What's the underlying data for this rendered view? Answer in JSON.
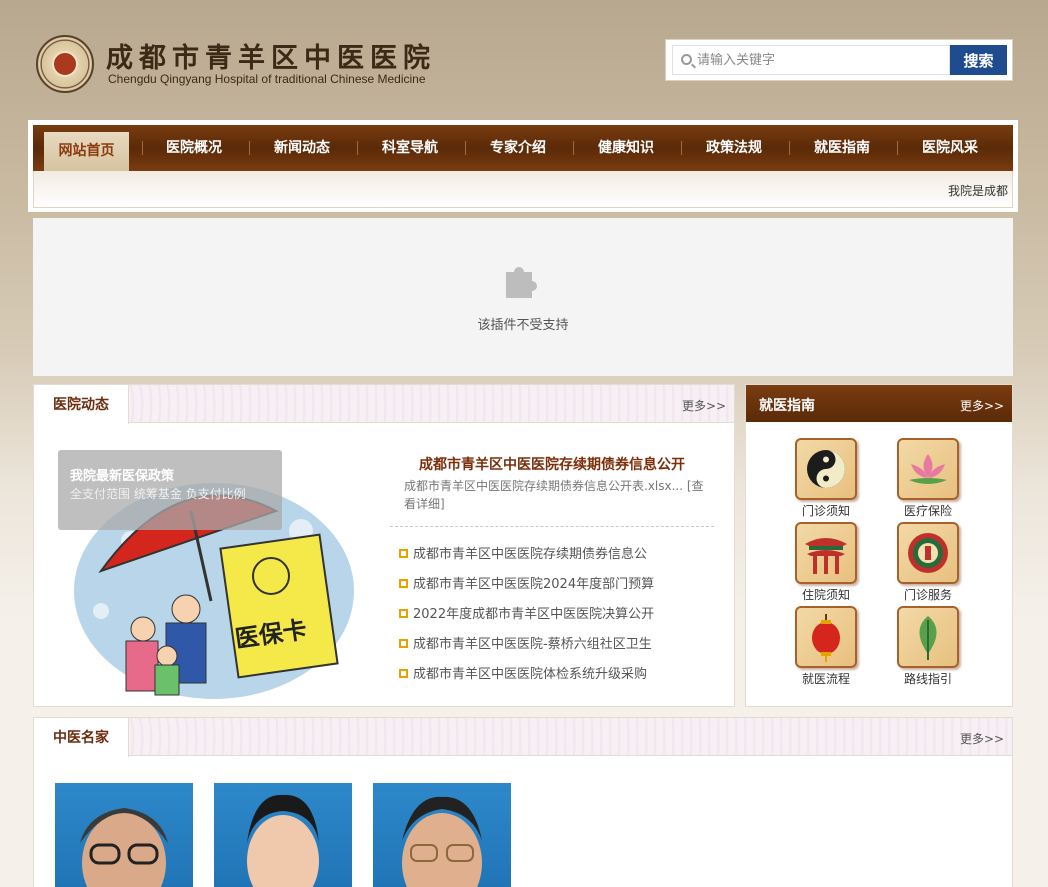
{
  "header": {
    "title": "成都市青羊区中医医院",
    "subtitle": "Chengdu Qingyang Hospital of traditional Chinese Medicine"
  },
  "search": {
    "placeholder": "请输入关键字",
    "button_label": "搜索"
  },
  "nav": {
    "items": [
      {
        "label": "网站首页",
        "active": true
      },
      {
        "label": "医院概况"
      },
      {
        "label": "新闻动态"
      },
      {
        "label": "科室导航"
      },
      {
        "label": "专家介绍"
      },
      {
        "label": "健康知识"
      },
      {
        "label": "政策法规"
      },
      {
        "label": "就医指南"
      },
      {
        "label": "医院风采"
      }
    ],
    "marquee_text": "我院是成都"
  },
  "plugin": {
    "message": "该插件不受支持"
  },
  "news_panel": {
    "title": "医院动态",
    "more_label": "更多>>",
    "slide": {
      "title": "我院最新医保政策",
      "description": "全支付范围 统筹基金 负支付比例"
    },
    "featured": {
      "title": "成都市青羊区中医医院存续期债券信息公开",
      "description": "成都市青羊区中医医院存续期债券信息公开表.xlsx... [查看详细]"
    },
    "items": [
      "成都市青羊区中医医院存续期债券信息公",
      "成都市青羊区中医医院2024年度部门预算",
      "2022年度成都市青羊区中医医院决算公开",
      "成都市青羊区中医医院-蔡桥六组社区卫生",
      "成都市青羊区中医医院体检系统升级采购"
    ]
  },
  "guide_panel": {
    "title": "就医指南",
    "more_label": "更多>>",
    "items": [
      {
        "label": "门诊须知",
        "icon": "yin-yang-icon"
      },
      {
        "label": "医疗保险",
        "icon": "lotus-icon"
      },
      {
        "label": "住院须知",
        "icon": "pavilion-icon"
      },
      {
        "label": "门诊服务",
        "icon": "emblem-icon"
      },
      {
        "label": "就医流程",
        "icon": "lantern-icon"
      },
      {
        "label": "路线指引",
        "icon": "leaf-icon"
      }
    ]
  },
  "experts_panel": {
    "title": "中医名家",
    "more_label": "更多>>"
  },
  "colors": {
    "nav_brown": "#5a2a08",
    "search_blue": "#1e4c8f",
    "accent_text": "#7a2f0a",
    "bullet": "#e3a400"
  }
}
